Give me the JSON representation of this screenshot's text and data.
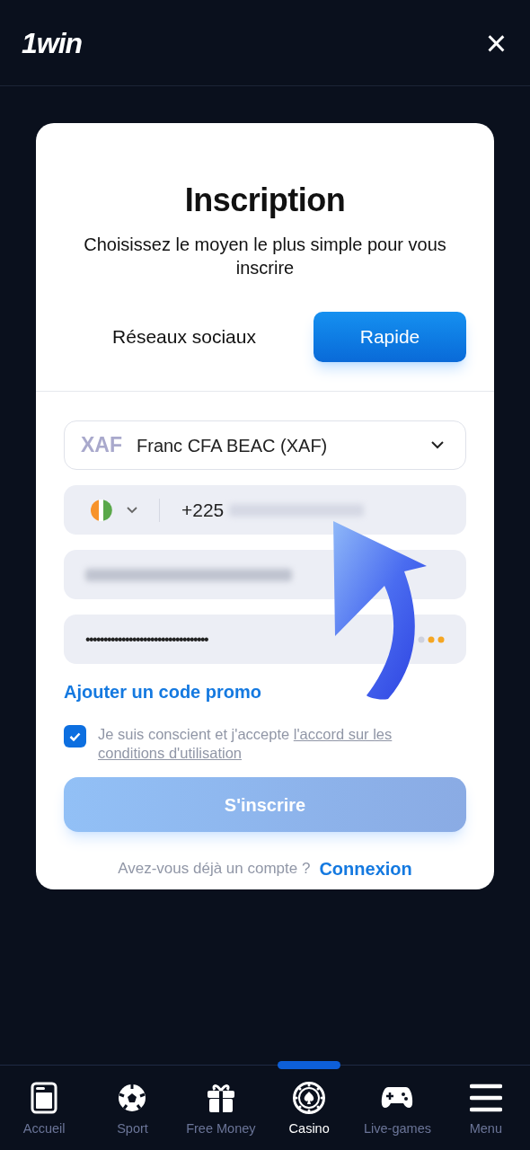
{
  "header": {
    "logo": "1win",
    "close": "×"
  },
  "modal": {
    "title": "Inscription",
    "subtitle": "Choisissez le moyen le plus simple pour vous inscrire",
    "tabs": [
      {
        "label": "Réseaux sociaux",
        "selected": false
      },
      {
        "label": "Rapide",
        "selected": true
      }
    ],
    "currency": {
      "code": "XAF",
      "name": "Franc CFA BEAC (XAF)"
    },
    "phone": {
      "prefix": "+225"
    },
    "password": {
      "value": "••••••••••••••••••••••••••••••••••"
    },
    "promo_link": "Ajouter un code promo",
    "terms": {
      "checked": true,
      "text": "Je suis conscient et j'accepte ",
      "link_lines": [
        "l'accord sur les",
        "conditions d'utilisation"
      ]
    },
    "submit": "S'inscrire",
    "login": {
      "text": "Avez-vous déjà un compte ?",
      "link": "Connexion"
    }
  },
  "nav": [
    {
      "label": "Accueil",
      "kind": "home",
      "selected": false
    },
    {
      "label": "Sport",
      "kind": "ball",
      "selected": false
    },
    {
      "label": "Free Money",
      "kind": "gift",
      "selected": false
    },
    {
      "label": "Casino",
      "kind": "chip",
      "selected": true
    },
    {
      "label": "Live-games",
      "kind": "pad",
      "selected": false
    },
    {
      "label": "Menu",
      "kind": "menu",
      "selected": false
    }
  ]
}
